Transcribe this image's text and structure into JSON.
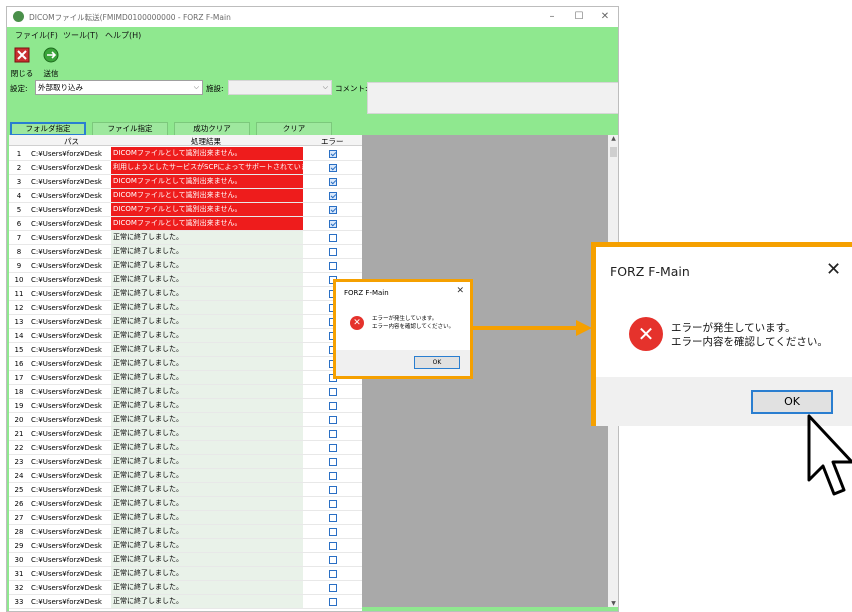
{
  "window": {
    "title": "DICOMファイル転送(FMIMD0100000000 - FORZ F-Main",
    "min": "–",
    "max": "☐",
    "close": "✕"
  },
  "menu": [
    "ファイル(F)",
    "ツール(T)",
    "ヘルプ(H)"
  ],
  "toolbar": {
    "close_label": "閉じる",
    "send_label": "送信"
  },
  "settings": {
    "setting_label": "設定:",
    "setting_value": "外部取り込み",
    "facility_label": "施設:",
    "facility_value": "",
    "comment_label": "コメント:"
  },
  "actions": [
    "フォルダ指定",
    "ファイル指定",
    "成功クリア",
    "クリア"
  ],
  "grid": {
    "headers": {
      "path": "パス",
      "result": "処理結果",
      "error": "エラー"
    },
    "rows": [
      {
        "num": "1",
        "path": "C:¥Users¥forz¥Desk",
        "result": "DICOMファイルとして識別出来ません。",
        "error": true
      },
      {
        "num": "2",
        "path": "C:¥Users¥forz¥Desk",
        "result": "利用しようとしたサービスがSCPによってサポートされていません。",
        "error": true
      },
      {
        "num": "3",
        "path": "C:¥Users¥forz¥Desk",
        "result": "DICOMファイルとして識別出来ません。",
        "error": true
      },
      {
        "num": "4",
        "path": "C:¥Users¥forz¥Desk",
        "result": "DICOMファイルとして識別出来ません。",
        "error": true
      },
      {
        "num": "5",
        "path": "C:¥Users¥forz¥Desk",
        "result": "DICOMファイルとして識別出来ません。",
        "error": true
      },
      {
        "num": "6",
        "path": "C:¥Users¥forz¥Desk",
        "result": "DICOMファイルとして識別出来ません。",
        "error": true
      },
      {
        "num": "7",
        "path": "C:¥Users¥forz¥Desk",
        "result": "正常に終了しました。",
        "error": false
      },
      {
        "num": "8",
        "path": "C:¥Users¥forz¥Desk",
        "result": "正常に終了しました。",
        "error": false
      },
      {
        "num": "9",
        "path": "C:¥Users¥forz¥Desk",
        "result": "正常に終了しました。",
        "error": false
      },
      {
        "num": "10",
        "path": "C:¥Users¥forz¥Desk",
        "result": "正常に終了しました。",
        "error": false
      },
      {
        "num": "11",
        "path": "C:¥Users¥forz¥Desk",
        "result": "正常に終了しました。",
        "error": false
      },
      {
        "num": "12",
        "path": "C:¥Users¥forz¥Desk",
        "result": "正常に終了しました。",
        "error": false
      },
      {
        "num": "13",
        "path": "C:¥Users¥forz¥Desk",
        "result": "正常に終了しました。",
        "error": false
      },
      {
        "num": "14",
        "path": "C:¥Users¥forz¥Desk",
        "result": "正常に終了しました。",
        "error": false
      },
      {
        "num": "15",
        "path": "C:¥Users¥forz¥Desk",
        "result": "正常に終了しました。",
        "error": false
      },
      {
        "num": "16",
        "path": "C:¥Users¥forz¥Desk",
        "result": "正常に終了しました。",
        "error": false
      },
      {
        "num": "17",
        "path": "C:¥Users¥forz¥Desk",
        "result": "正常に終了しました。",
        "error": false
      },
      {
        "num": "18",
        "path": "C:¥Users¥forz¥Desk",
        "result": "正常に終了しました。",
        "error": false
      },
      {
        "num": "19",
        "path": "C:¥Users¥forz¥Desk",
        "result": "正常に終了しました。",
        "error": false
      },
      {
        "num": "20",
        "path": "C:¥Users¥forz¥Desk",
        "result": "正常に終了しました。",
        "error": false
      },
      {
        "num": "21",
        "path": "C:¥Users¥forz¥Desk",
        "result": "正常に終了しました。",
        "error": false
      },
      {
        "num": "22",
        "path": "C:¥Users¥forz¥Desk",
        "result": "正常に終了しました。",
        "error": false
      },
      {
        "num": "23",
        "path": "C:¥Users¥forz¥Desk",
        "result": "正常に終了しました。",
        "error": false
      },
      {
        "num": "24",
        "path": "C:¥Users¥forz¥Desk",
        "result": "正常に終了しました。",
        "error": false
      },
      {
        "num": "25",
        "path": "C:¥Users¥forz¥Desk",
        "result": "正常に終了しました。",
        "error": false
      },
      {
        "num": "26",
        "path": "C:¥Users¥forz¥Desk",
        "result": "正常に終了しました。",
        "error": false
      },
      {
        "num": "27",
        "path": "C:¥Users¥forz¥Desk",
        "result": "正常に終了しました。",
        "error": false
      },
      {
        "num": "28",
        "path": "C:¥Users¥forz¥Desk",
        "result": "正常に終了しました。",
        "error": false
      },
      {
        "num": "29",
        "path": "C:¥Users¥forz¥Desk",
        "result": "正常に終了しました。",
        "error": false
      },
      {
        "num": "30",
        "path": "C:¥Users¥forz¥Desk",
        "result": "正常に終了しました。",
        "error": false
      },
      {
        "num": "31",
        "path": "C:¥Users¥forz¥Desk",
        "result": "正常に終了しました。",
        "error": false
      },
      {
        "num": "32",
        "path": "C:¥Users¥forz¥Desk",
        "result": "正常に終了しました。",
        "error": false
      },
      {
        "num": "33",
        "path": "C:¥Users¥forz¥Desk",
        "result": "正常に終了しました。",
        "error": false
      }
    ]
  },
  "dialog": {
    "title": "FORZ F-Main",
    "close": "✕",
    "message_line1": "エラーが発生しています。",
    "message_line2": "エラー内容を確認してください。",
    "icon": "✕",
    "ok_label": "OK"
  },
  "colors": {
    "accent": "#f5a000",
    "window_bg": "#8fe88f",
    "error_row": "#ee1c1c",
    "focus": "#2a7ed0"
  }
}
